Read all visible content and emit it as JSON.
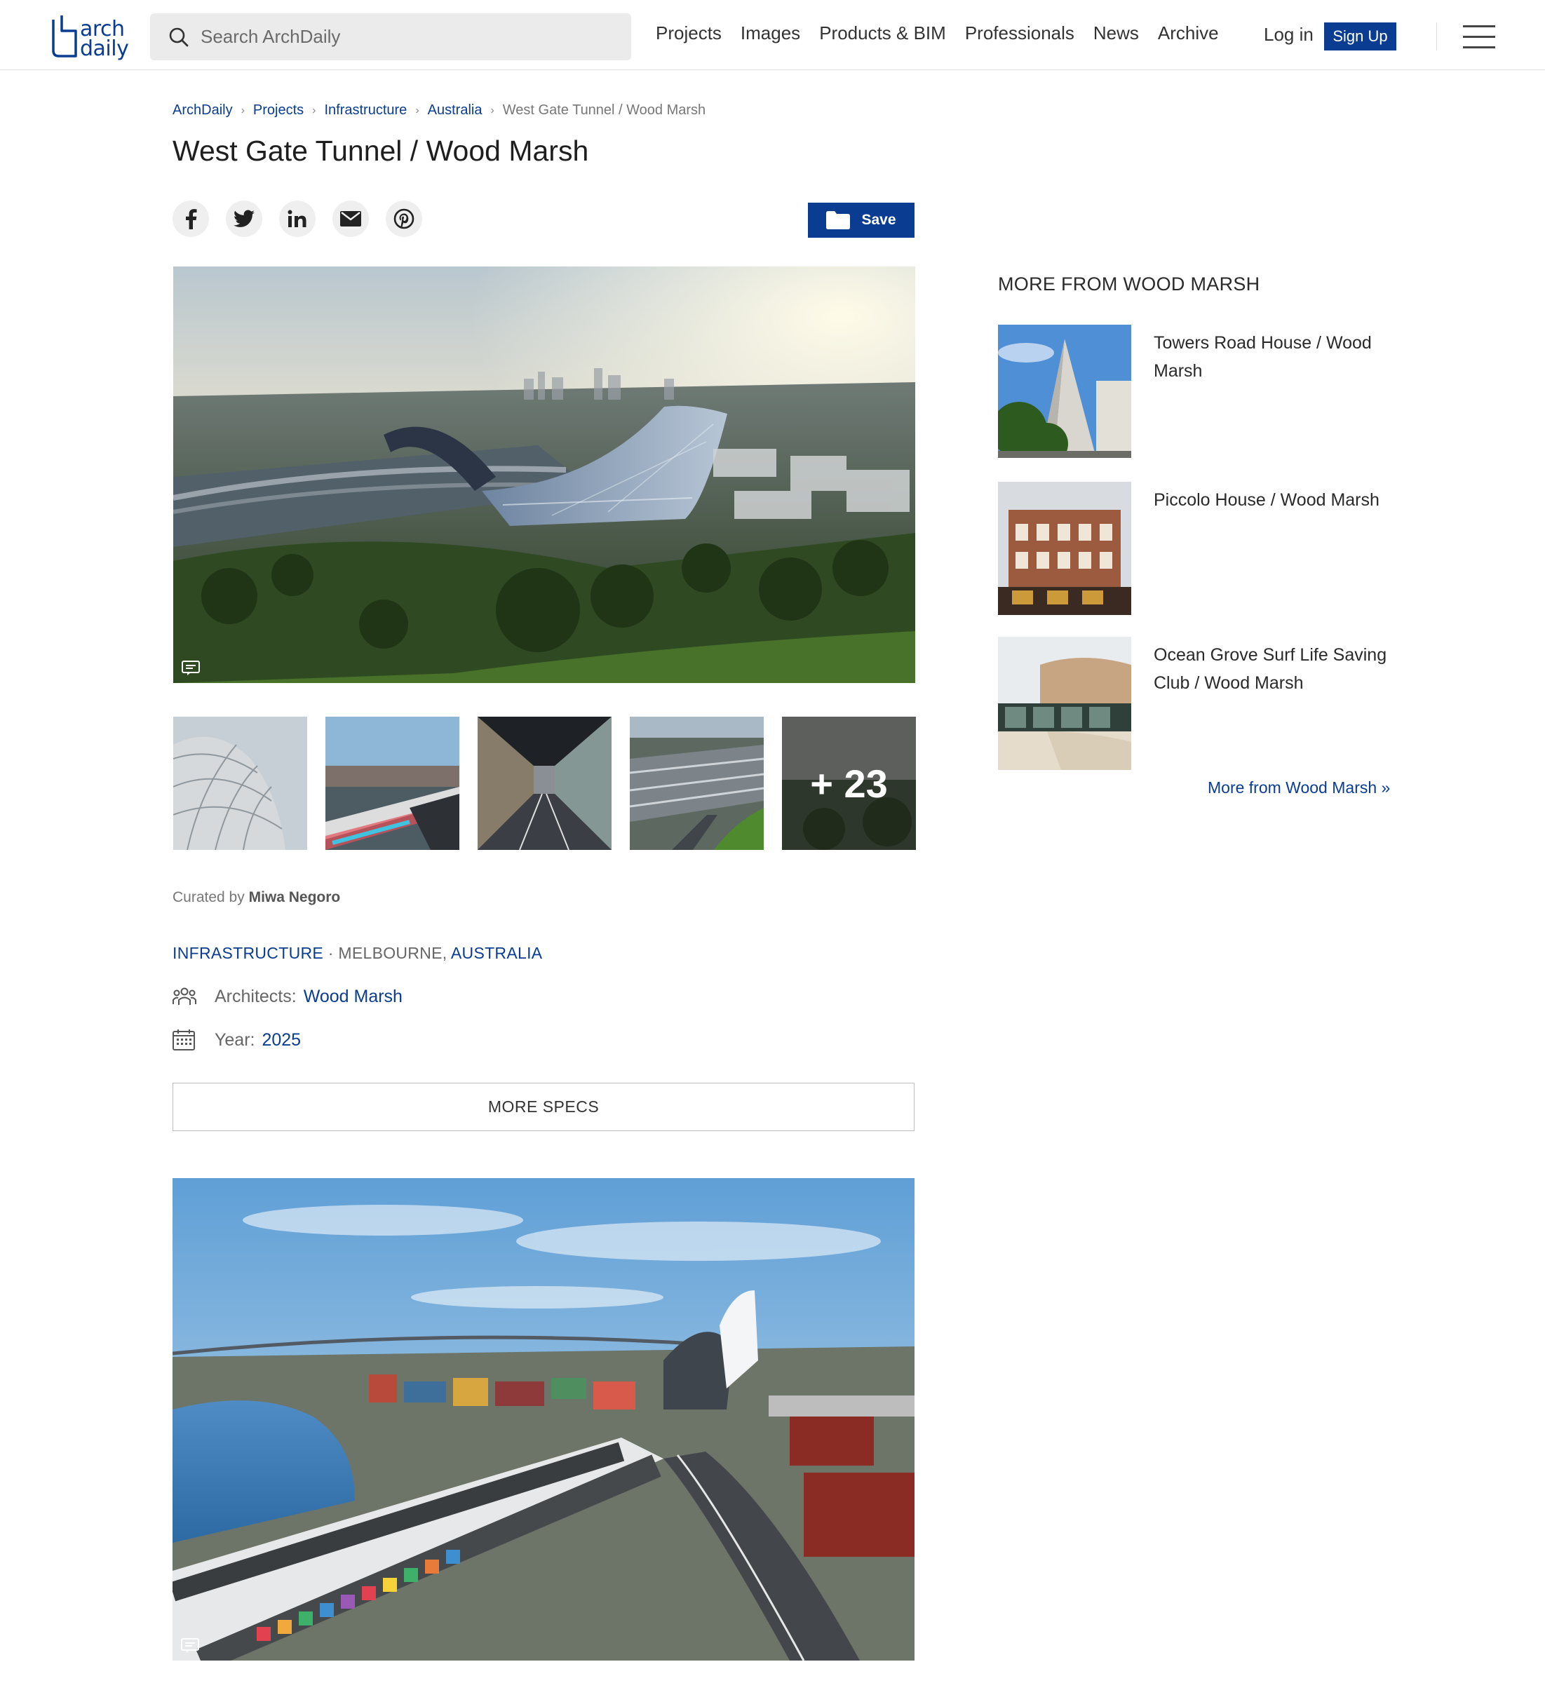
{
  "header": {
    "logo_text_1": "arch",
    "logo_text_2": "daily",
    "search_placeholder": "Search ArchDaily",
    "nav": [
      "Projects",
      "Images",
      "Products & BIM",
      "Professionals",
      "News",
      "Archive"
    ],
    "login": "Log in",
    "signup": "Sign Up"
  },
  "breadcrumb": [
    "ArchDaily",
    "Projects",
    "Infrastructure",
    "Australia"
  ],
  "breadcrumb_current": "West Gate Tunnel / Wood Marsh",
  "title": "West Gate Tunnel / Wood Marsh",
  "save_label": "Save",
  "share_icons": [
    "facebook-icon",
    "twitter-icon",
    "linkedin-icon",
    "email-icon",
    "pinterest-icon"
  ],
  "gallery": {
    "more_count": "+ 23"
  },
  "curated": {
    "prefix": "Curated by",
    "name": "Miwa Negoro"
  },
  "taxonomy": {
    "category": "INFRASTRUCTURE",
    "separator": " · ",
    "city": "MELBOURNE, ",
    "country": "AUSTRALIA"
  },
  "specs": {
    "architects_label": "Architects:",
    "architects_value": "Wood Marsh",
    "year_label": "Year:",
    "year_value": "2025",
    "more_specs": "MORE SPECS"
  },
  "sidebar": {
    "title": "MORE FROM WOOD MARSH",
    "items": [
      {
        "name": "Towers Road House / Wood Marsh"
      },
      {
        "name": "Piccolo House / Wood Marsh"
      },
      {
        "name": "Ocean Grove Surf Life Saving Club / Wood Marsh"
      }
    ],
    "more_link": "More from Wood Marsh »"
  },
  "colors": {
    "brand": "#0a3d91",
    "text": "#222222",
    "muted": "#777777"
  }
}
